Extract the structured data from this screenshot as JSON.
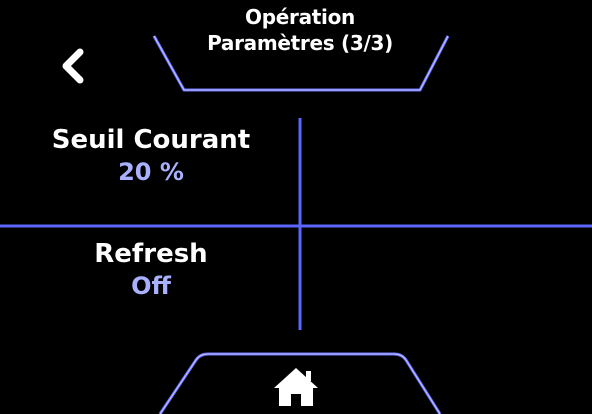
{
  "header": {
    "title_line1": "Opération",
    "title_line2": "Paramètres (3/3)"
  },
  "settings": [
    {
      "label": "Seuil Courant",
      "value": "20 %"
    },
    {
      "label": "Refresh",
      "value": "Off"
    }
  ],
  "icons": {
    "back": "chevron-left-icon",
    "home": "home-icon"
  },
  "colors": {
    "background": "#000000",
    "lines": "#5b66ff",
    "label": "#ffffff",
    "value": "#a9b1ff"
  }
}
